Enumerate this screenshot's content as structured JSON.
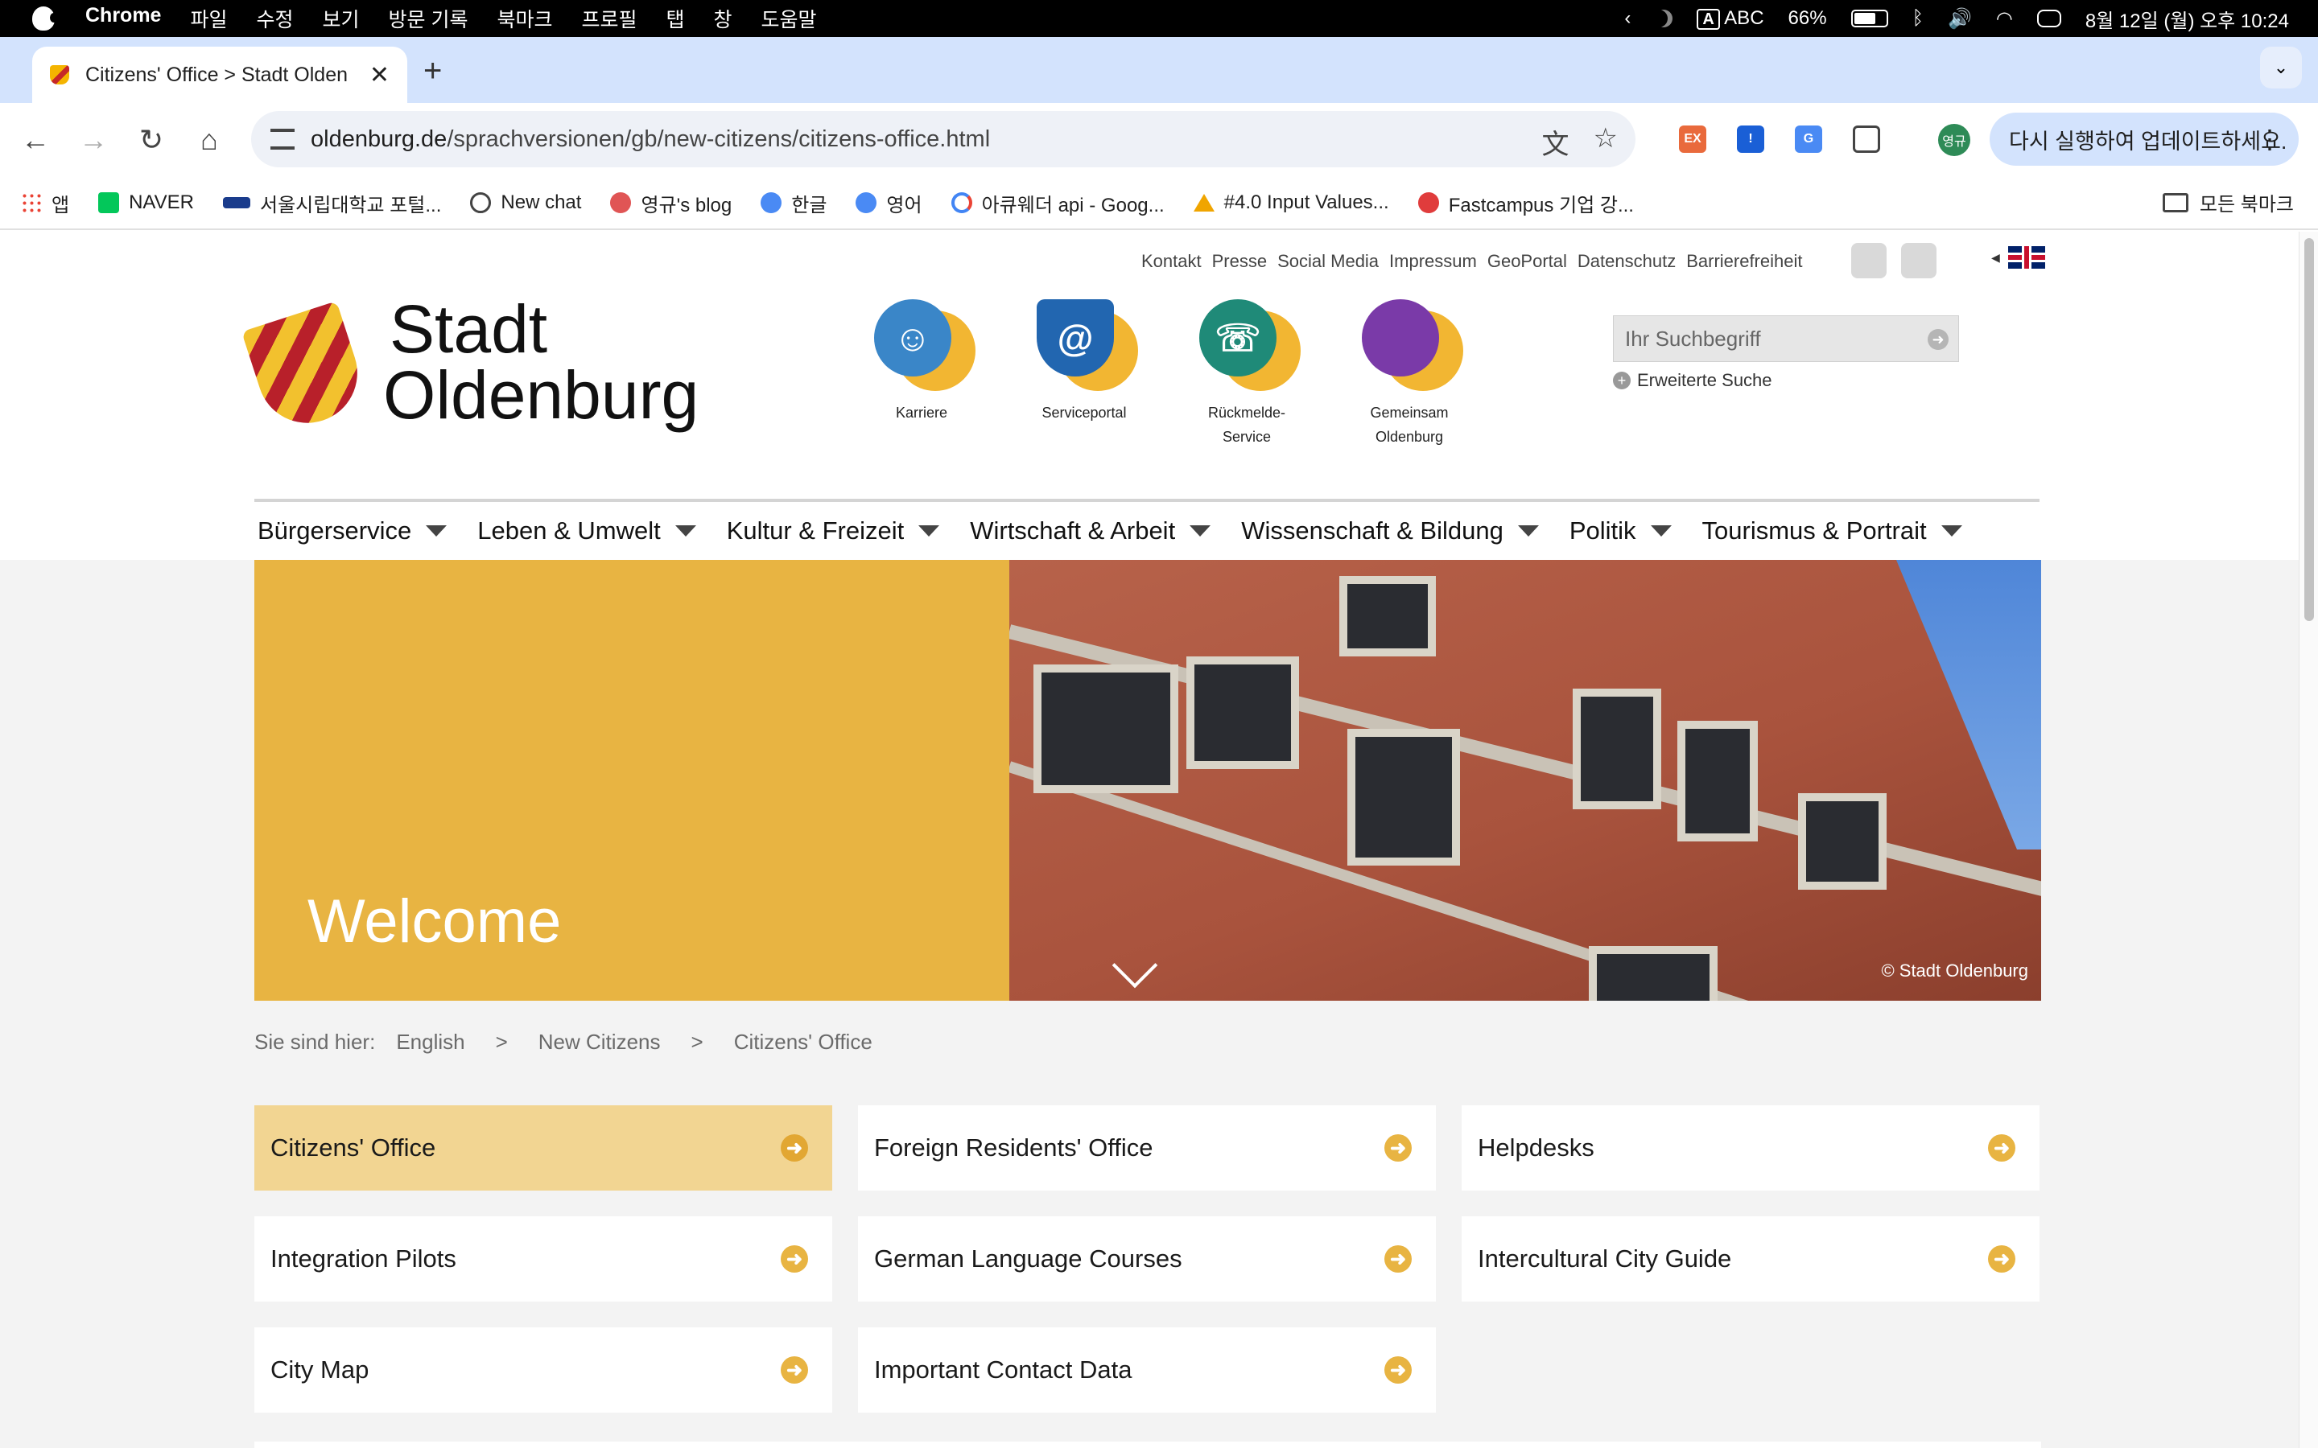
{
  "menubar": {
    "app": "Chrome",
    "menus": [
      "파일",
      "수정",
      "보기",
      "방문 기록",
      "북마크",
      "프로필",
      "탭",
      "창",
      "도움말"
    ],
    "input_mode_badge": "A",
    "input_mode": "ABC",
    "battery": "66%",
    "datetime": "8월 12일 (월) 오후 10:24"
  },
  "tab": {
    "title": "Citizens' Office > Stadt Olden",
    "close": "✕"
  },
  "toolbar": {
    "url_host": "oldenburg.de",
    "url_path": "/sprachversionen/gb/new-citizens/citizens-office.html",
    "profile_initials": "영규",
    "update_label": "다시 실행하여 업데이트하세요.",
    "extension_label": "EX"
  },
  "bookmarks": [
    {
      "label": "앱",
      "color": "#ea4335"
    },
    {
      "label": "NAVER",
      "color": "#03c75a"
    },
    {
      "label": "서울시립대학교 포털...",
      "color": "#1a3c8c"
    },
    {
      "label": "New chat",
      "color": "#444444"
    },
    {
      "label": "영규's blog",
      "color": "#e05555"
    },
    {
      "label": "한글",
      "color": "#4a8af4"
    },
    {
      "label": "영어",
      "color": "#4a8af4"
    },
    {
      "label": "아큐웨더 api - Goog...",
      "color": "#4285f4"
    },
    {
      "label": "#4.0 Input Values...",
      "color": "#f0a500"
    },
    {
      "label": "Fastcampus 기업 강...",
      "color": "#e03c3c"
    }
  ],
  "bookmarks_all": "모든 북마크",
  "site": {
    "toplinks": [
      "Kontakt",
      "Presse",
      "Social Media",
      "Impressum",
      "GeoPortal",
      "Datenschutz",
      "Barrierefreiheit"
    ],
    "logo_line1": "Stadt",
    "logo_line2": "Oldenburg",
    "quicklinks": [
      {
        "label": "Karriere",
        "icon": "people-icon",
        "glyph": "☺",
        "color": "#3a86c8"
      },
      {
        "label": "Serviceportal",
        "icon": "at-sign-icon",
        "glyph": "@",
        "color": "#2266b0"
      },
      {
        "label": "Rückmelde-Service",
        "icon": "headset-icon",
        "glyph": "☏",
        "color": "#1f8a78"
      },
      {
        "label": "Gemeinsam Oldenburg",
        "icon": "speech-bubbles-icon",
        "glyph": "",
        "color": "#7a3aa8"
      }
    ],
    "search_placeholder": "Ihr Suchbegriff",
    "advanced_search": "Erweiterte Suche",
    "nav": [
      "Bürgerservice",
      "Leben & Umwelt",
      "Kultur & Freizeit",
      "Wirtschaft & Arbeit",
      "Wissenschaft & Bildung",
      "Politik",
      "Tourismus & Portrait"
    ],
    "hero_title": "Welcome",
    "hero_credit": "© Stadt Oldenburg",
    "breadcrumb_prefix": "Sie sind hier:",
    "breadcrumb": [
      "English",
      "New Citizens",
      "Citizens' Office"
    ],
    "breadcrumb_sep": ">",
    "tiles": [
      {
        "label": "Citizens' Office",
        "active": true
      },
      {
        "label": "Foreign Residents' Office",
        "active": false
      },
      {
        "label": "Helpdesks",
        "active": false
      },
      {
        "label": "Integration Pilots",
        "active": false
      },
      {
        "label": "German Language Courses",
        "active": false
      },
      {
        "label": "Intercultural City Guide",
        "active": false
      },
      {
        "label": "City Map",
        "active": false
      },
      {
        "label": "Important Contact Data",
        "active": false
      }
    ],
    "colors": {
      "accent": "#e8b442",
      "active_tile": "#f2d592",
      "shield_red": "#b8202a"
    }
  }
}
